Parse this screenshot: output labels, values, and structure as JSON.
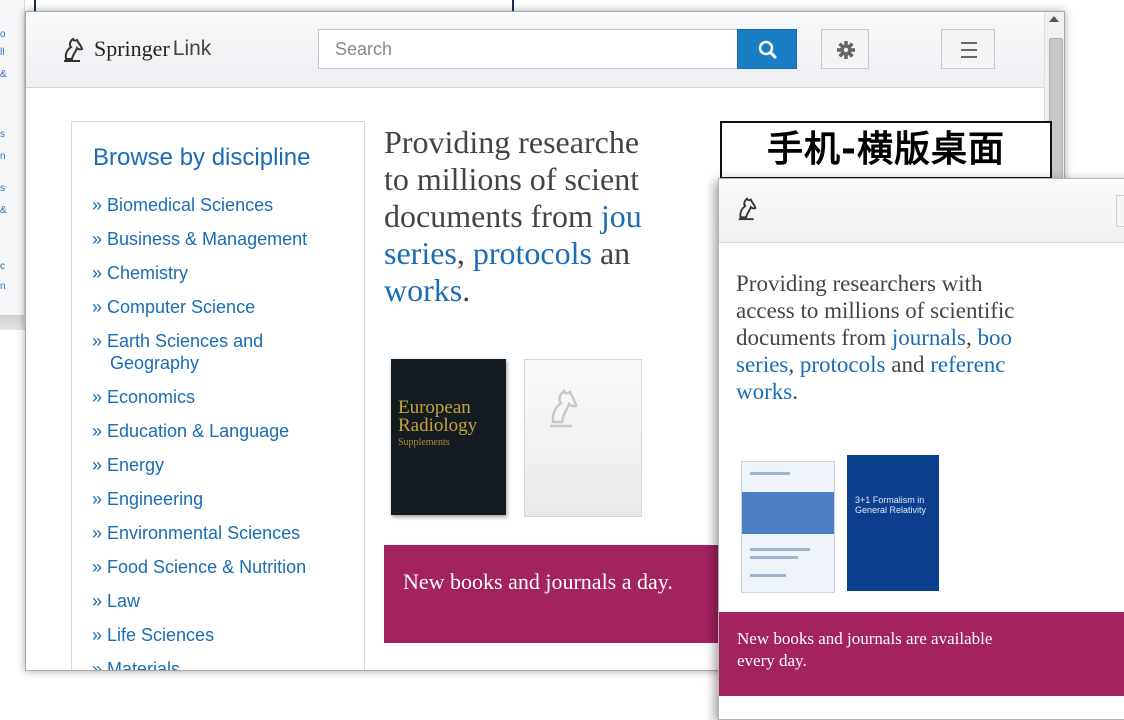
{
  "desktop": {
    "brand": {
      "name_a": "Springer",
      "name_b": "Link"
    },
    "search": {
      "placeholder": "Search"
    },
    "discipline": {
      "heading": "Browse by discipline",
      "items": [
        "» Biomedical Sciences",
        "» Business & Management",
        "» Chemistry",
        "» Computer Science",
        "» Earth Sciences and Geography",
        "» Economics",
        "» Education & Language",
        "» Energy",
        "» Engineering",
        "» Environmental Sciences",
        "» Food Science & Nutrition",
        "» Law",
        "» Life Sciences",
        "» Materials"
      ]
    },
    "hero": {
      "l1": "Providing researche",
      "l2": "to millions of scient",
      "l3a": "documents from ",
      "l3b": "jou",
      "l4a": "series",
      "l4b": ", ",
      "l4c": "protocols",
      "l4d": " an",
      "l5a": "works",
      "l5b": "."
    },
    "cover": {
      "title": "European Radiology",
      "subtitle": "Supplements"
    },
    "banner": "New books and journals a day."
  },
  "caption": "手机-横版桌面",
  "phone": {
    "hero": {
      "l1": "Providing researchers with",
      "l2": "access to millions of scientific",
      "l3a": "documents from ",
      "l3b": "journals",
      "l3c": ", ",
      "l3d": "boo",
      "l4a": "series",
      "l4b": ", ",
      "l4c": "protocols",
      "l4d": " and ",
      "l4e": "referenc",
      "l5a": "works",
      "l5b": "."
    },
    "cover_2_title": "3+1 Formalism in General Relativity",
    "banner_l1": "New books and journals are available",
    "banner_l2": "every day."
  },
  "colors": {
    "link": "#1a6cb5",
    "banner": "#a3235f",
    "search_button": "#1b7ec5"
  },
  "icons": [
    "springer-horse-icon",
    "search-icon",
    "gear-icon",
    "hamburger-menu-icon"
  ]
}
